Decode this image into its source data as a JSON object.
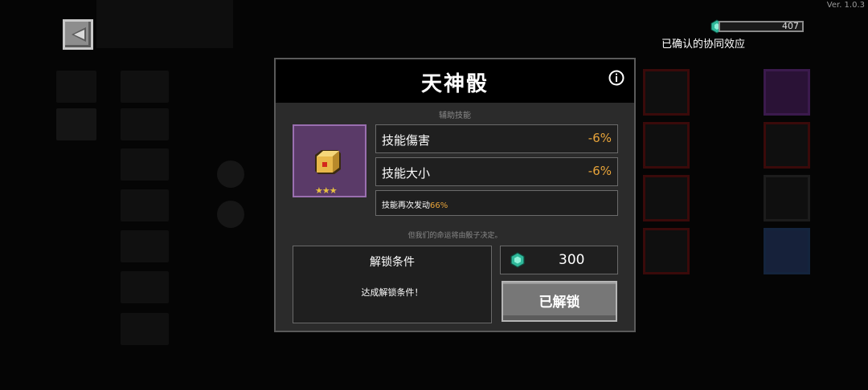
{
  "version": "Ver. 1.0.3",
  "currency": {
    "gems": "407"
  },
  "synergy_label": "已确认的协同效应",
  "modal": {
    "title": "天神骰",
    "category": "辅助技能",
    "item": {
      "icon": "dice-icon",
      "stars": "★★★",
      "rarity_color": "#5a3a68"
    },
    "stats": [
      {
        "label": "技能傷害",
        "value": "-6%"
      },
      {
        "label": "技能大小",
        "value": "-6%"
      }
    ],
    "effect": {
      "text": "技能再次发动",
      "highlight": "66%"
    },
    "flavor": "但我们的命运将由骰子决定。",
    "unlock": {
      "title": "解锁条件",
      "text": "达成解锁条件！"
    },
    "price": "300",
    "button_label": "已解锁"
  },
  "colors": {
    "accent": "#e8a43a",
    "gem": "#2fb89a",
    "modal_bg": "#2b2b2b"
  }
}
